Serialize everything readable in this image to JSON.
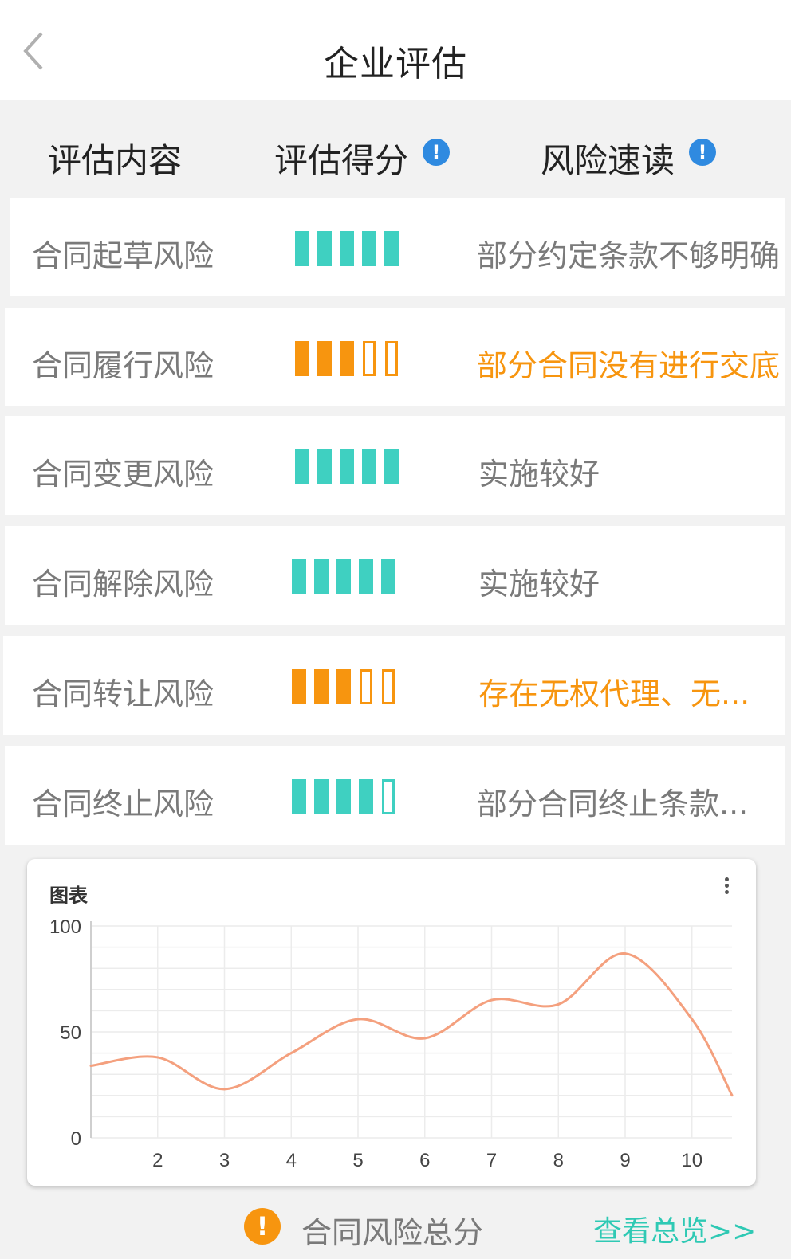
{
  "header": {
    "title": "企业评估",
    "back_icon": "chevron-left-icon"
  },
  "columns": {
    "content": "评估内容",
    "score": "评估得分",
    "risk": "风险速读",
    "info_icon": "info-icon"
  },
  "rows": [
    {
      "name": "合同起草风险",
      "score": 5,
      "max": 5,
      "color": "#3fd0c1",
      "note": "部分约定条款不够明确",
      "warn": false
    },
    {
      "name": "合同履行风险",
      "score": 3,
      "max": 5,
      "color": "#f7950f",
      "note": "部分合同没有进行交底",
      "warn": true
    },
    {
      "name": "合同变更风险",
      "score": 5,
      "max": 5,
      "color": "#3fd0c1",
      "note": "实施较好",
      "warn": false
    },
    {
      "name": "合同解除风险",
      "score": 5,
      "max": 5,
      "color": "#3fd0c1",
      "note": "实施较好",
      "warn": false
    },
    {
      "name": "合同转让风险",
      "score": 3,
      "max": 5,
      "color": "#f7950f",
      "note": "存在无权代理、无...",
      "warn": true
    },
    {
      "name": "合同终止风险",
      "score": 4,
      "max": 5,
      "color": "#3fd0c1",
      "note": "部分合同终止条款...",
      "warn": false
    }
  ],
  "chart": {
    "title": "图表",
    "menu_icon": "more-vertical-icon"
  },
  "chart_data": {
    "type": "line",
    "title": "图表",
    "x": [
      1,
      2,
      3,
      4,
      5,
      6,
      7,
      8,
      9,
      10,
      10.6
    ],
    "x_ticks": [
      "2",
      "3",
      "4",
      "5",
      "6",
      "7",
      "8",
      "9",
      "10"
    ],
    "y_ticks": [
      "0",
      "50",
      "100"
    ],
    "ylim": [
      0,
      100
    ],
    "series": [
      {
        "values": [
          34,
          38,
          23,
          40,
          56,
          47,
          65,
          63,
          87,
          56,
          20
        ],
        "color": "#f4a07e"
      }
    ],
    "grid": true,
    "legend": "none"
  },
  "footer": {
    "alert_icon": "!",
    "label": "合同风险总分",
    "link": "查看总览>>"
  }
}
